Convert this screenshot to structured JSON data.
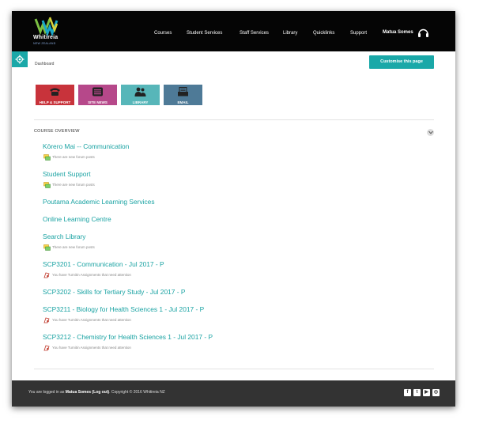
{
  "brand": {
    "name": "Whitireia",
    "subtitle": "NEW ZEALAND"
  },
  "nav": {
    "items": [
      "Courses",
      "Student Services",
      "Staff Services",
      "Library",
      "Quicklinks",
      "Support"
    ]
  },
  "user": {
    "name": "Matua Somes"
  },
  "breadcrumb": "Dashboard",
  "customise_label": "Customise this page",
  "tiles": [
    {
      "label": "HELP & SUPPORT",
      "color": "#c8333b"
    },
    {
      "label": "SITE NEWS",
      "color": "#b6488a"
    },
    {
      "label": "LIBRARY",
      "color": "#57b6b9"
    },
    {
      "label": "EMAIL",
      "color": "#4e7a97"
    }
  ],
  "course_overview": {
    "title": "COURSE OVERVIEW",
    "courses": [
      {
        "name": "Kōrero Mai -- Communication",
        "note": "There are new forum posts",
        "note_icon": "forum-icon"
      },
      {
        "name": "Student Support",
        "note": "There are new forum posts",
        "note_icon": "forum-icon"
      },
      {
        "name": "Poutama Academic Learning Services",
        "note": "",
        "note_icon": ""
      },
      {
        "name": "Online Learning Centre",
        "note": "",
        "note_icon": ""
      },
      {
        "name": "Search Library",
        "note": "There are new forum posts",
        "note_icon": "forum-icon"
      },
      {
        "name": "SCP3201 - Communication - Jul 2017 - P",
        "note": "You have Turnitin Assignments that need attention",
        "note_icon": "assignment-icon"
      },
      {
        "name": "SCP3202 - Skills for Tertiary Study - Jul 2017 - P",
        "note": "",
        "note_icon": ""
      },
      {
        "name": "SCP3211 - Biology for Health Sciences 1 - Jul 2017 - P",
        "note": "You have Turnitin Assignments that need attention",
        "note_icon": "assignment-icon"
      },
      {
        "name": "SCP3212 - Chemistry for Health Sciences 1 - Jul 2017 - P",
        "note": "You have Turnitin Assignments that need attention",
        "note_icon": "assignment-icon"
      }
    ]
  },
  "footer": {
    "logged_in_prefix": "You are logged in as ",
    "user": "Matua Somes",
    "logout": "(Log out)",
    "copyright": ". Copyright © 2016 Whitireia NZ",
    "social": [
      "facebook-icon",
      "twitter-icon",
      "youtube-icon",
      "instagram-icon"
    ]
  },
  "colors": {
    "accent": "#1aa8a8",
    "topbar": "#050505",
    "footer": "#333333"
  }
}
